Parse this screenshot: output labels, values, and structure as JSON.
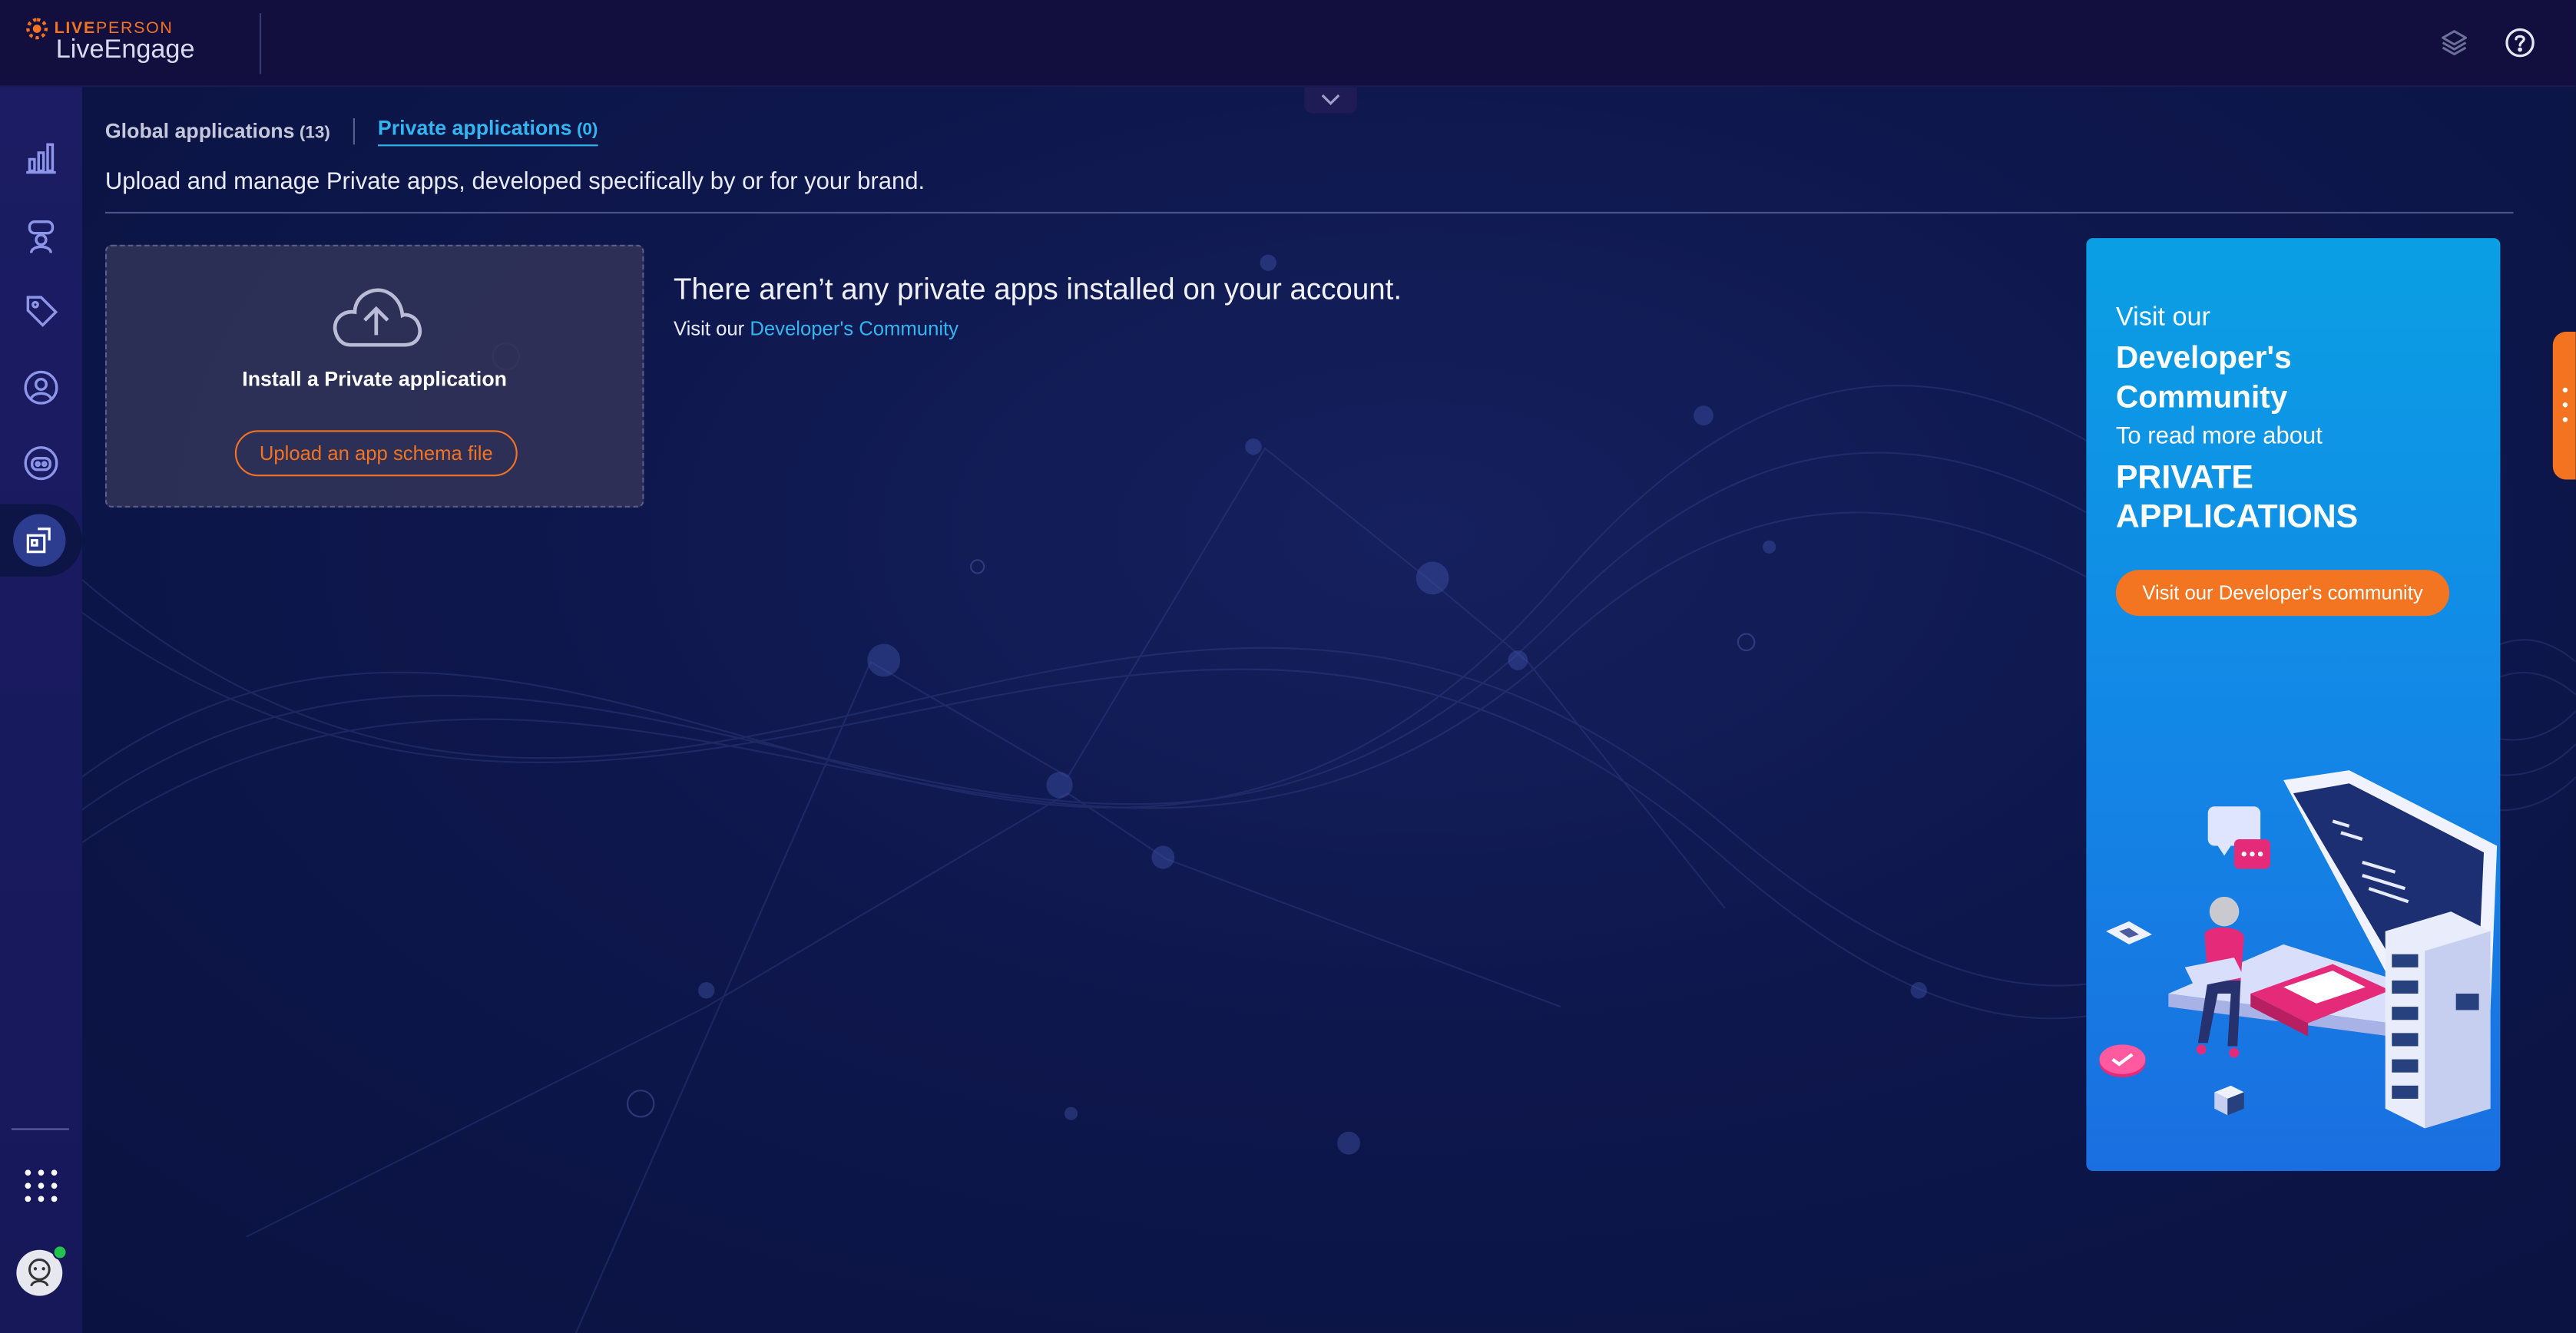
{
  "header": {
    "brand": "LIVE",
    "brand_person": "PERSON",
    "product": "LiveEngage",
    "icons": [
      "layers-icon",
      "help-icon"
    ]
  },
  "sidebar": {
    "items": [
      {
        "icon": "analytics-chart-icon"
      },
      {
        "icon": "agent-workspace-icon"
      },
      {
        "icon": "tag-icon"
      },
      {
        "icon": "user-profile-icon"
      },
      {
        "icon": "bot-icon"
      },
      {
        "icon": "apps-puzzle-icon",
        "active": true
      }
    ],
    "footer": [
      {
        "icon": "app-grid-icon"
      },
      {
        "icon": "user-avatar-icon",
        "status_color": "#23c14e"
      }
    ]
  },
  "tabs": {
    "global_label": "Global applications",
    "global_count": "(13)",
    "private_label": "Private applications",
    "private_count": "(0)"
  },
  "page": {
    "subtitle": "Upload and manage Private apps, developed specifically by or for your brand."
  },
  "install_card": {
    "title": "Install a Private application",
    "button": "Upload an app schema file"
  },
  "empty_state": {
    "title": "There aren’t any private apps installed on your account.",
    "prefix": "Visit our",
    "link": "Developer's Community"
  },
  "promo": {
    "line1": "Visit our",
    "line2": "Developer's Community",
    "line3": "To read more about",
    "line4": "PRIVATE APPLICATIONS",
    "button": "Visit our Developer's community"
  },
  "colors": {
    "accent_orange": "#f37321",
    "link_blue": "#33b6f0",
    "background": "#0e174c",
    "promo_blue": "#1386e6"
  }
}
